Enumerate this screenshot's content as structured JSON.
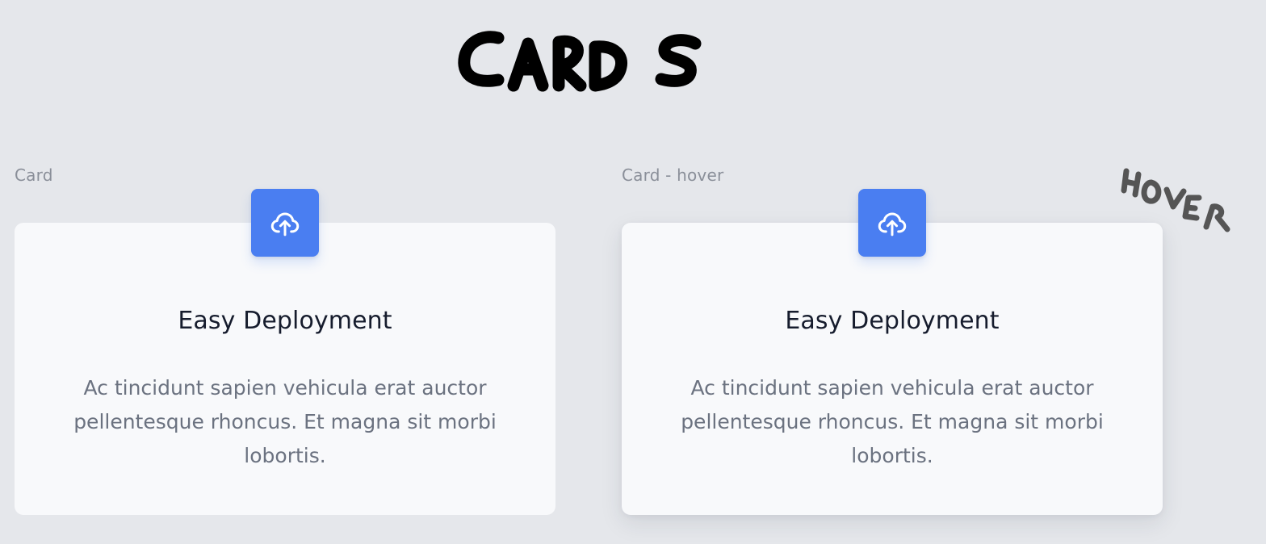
{
  "heading": {
    "title": "Cards"
  },
  "variants": [
    {
      "label": "Card",
      "state": "default",
      "card": {
        "icon": "cloud-upload-icon",
        "title": "Easy Deployment",
        "body": "Ac tincidunt sapien vehicula erat auctor pellentesque rhoncus. Et magna sit morbi lobortis."
      }
    },
    {
      "label": "Card - hover",
      "state": "hover",
      "card": {
        "icon": "cloud-upload-icon",
        "title": "Easy Deployment",
        "body": "Ac tincidunt sapien vehicula erat auctor pellentesque rhoncus. Et magna sit morbi lobortis."
      }
    }
  ],
  "annotations": {
    "hover_note": "Hover"
  },
  "colors": {
    "background": "#e5e7eb",
    "card_surface": "#f8f9fb",
    "accent": "#4a7ef1",
    "title_text": "#161c2d",
    "body_text": "#6b7280",
    "label_text": "#8a8f99"
  }
}
